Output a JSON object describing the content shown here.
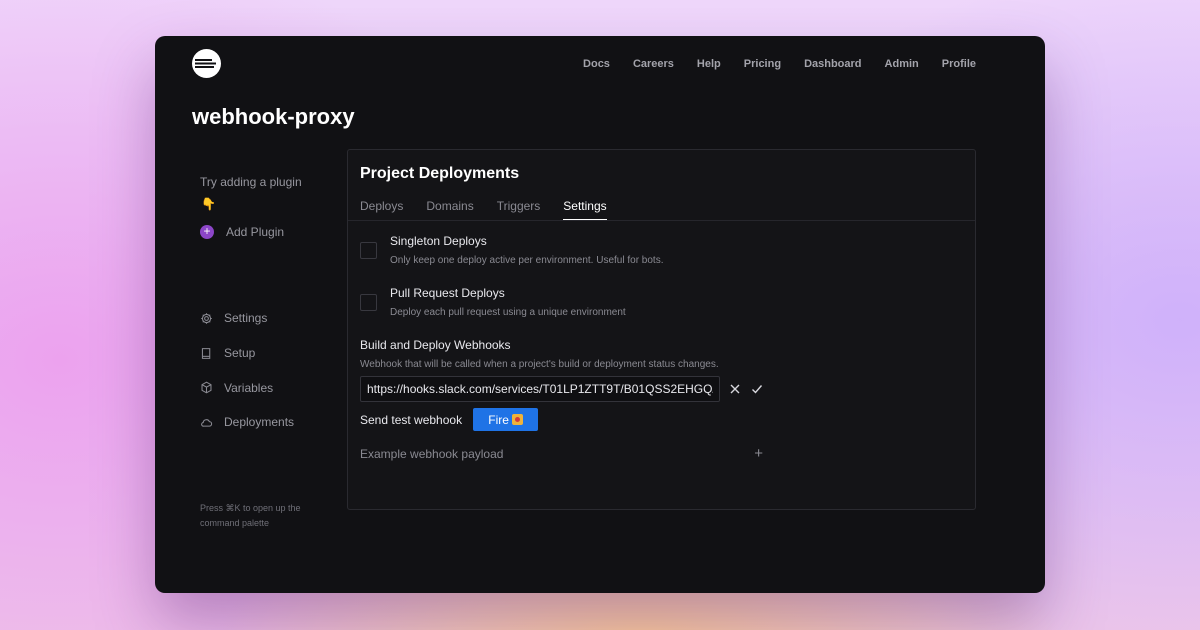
{
  "nav": {
    "items": [
      "Docs",
      "Careers",
      "Help",
      "Pricing",
      "Dashboard",
      "Admin",
      "Profile"
    ]
  },
  "project": {
    "name": "webhook-proxy"
  },
  "sidebar": {
    "hint": "Try adding a plugin",
    "hint_emoji": "👇",
    "add_plugin": "Add Plugin",
    "items": [
      {
        "label": "Settings",
        "icon": "gear-icon"
      },
      {
        "label": "Setup",
        "icon": "book-icon"
      },
      {
        "label": "Variables",
        "icon": "cube-icon"
      },
      {
        "label": "Deployments",
        "icon": "cloud-icon"
      }
    ],
    "palette_hint": "Press ⌘K to open up the command palette"
  },
  "panel": {
    "title": "Project Deployments",
    "tabs": [
      {
        "label": "Deploys"
      },
      {
        "label": "Domains"
      },
      {
        "label": "Triggers"
      },
      {
        "label": "Settings",
        "active": true
      }
    ],
    "options": [
      {
        "title": "Singleton Deploys",
        "description": "Only keep one deploy active per environment. Useful for bots.",
        "checked": false
      },
      {
        "title": "Pull Request Deploys",
        "description": "Deploy each pull request using a unique environment",
        "checked": false
      }
    ],
    "webhooks": {
      "title": "Build and Deploy Webhooks",
      "description": "Webhook that will be called when a project's build or deployment status changes.",
      "url_value": "https://hooks.slack.com/services/T01LP1ZTT9T/B01QSS2EHGQ/",
      "test_label": "Send test webhook",
      "fire_label": "Fire",
      "payload_label": "Example webhook payload",
      "payload_toggle": "+"
    }
  },
  "colors": {
    "accent": "#1f73e6",
    "plugin": "#8c46c8",
    "window_bg": "#111114"
  }
}
